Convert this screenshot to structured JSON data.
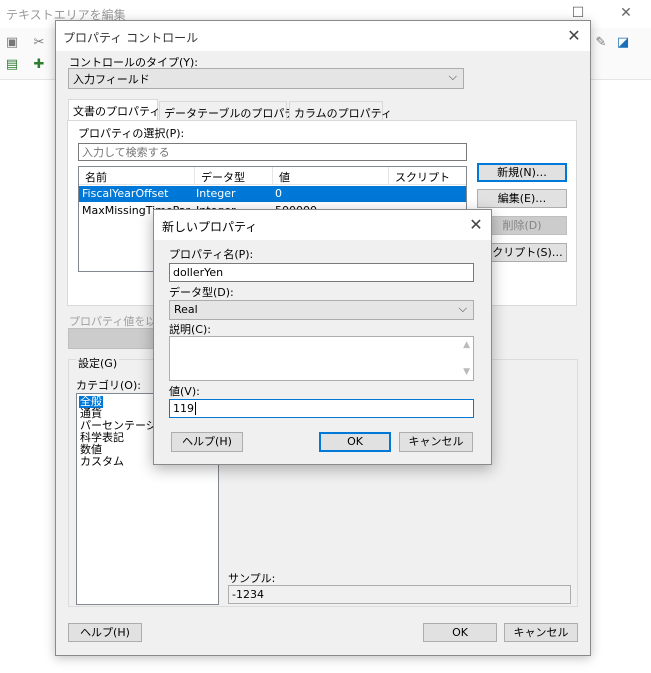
{
  "background_app": {
    "title": "テキストエリアを編集"
  },
  "property_dialog": {
    "title": "プロパティ コントロール",
    "control_type_label": "コントロールのタイプ(Y):",
    "control_type_value": "入力フィールド",
    "tabs": [
      {
        "label": "文書のプロパティ",
        "active": true
      },
      {
        "label": "データテーブルのプロパティ",
        "active": false
      },
      {
        "label": "カラムのプロパティ",
        "active": false
      }
    ],
    "select_property_label": "プロパティの選択(P):",
    "search_placeholder": "入力して検索する",
    "table": {
      "columns": [
        "名前",
        "データ型",
        "値",
        "スクリプト"
      ],
      "rows": [
        {
          "name": "FiscalYearOffset",
          "type": "Integer",
          "value": "0",
          "script": "",
          "selected": true
        },
        {
          "name": "MaxMissingTimePar...",
          "type": "Integer",
          "value": "500000",
          "script": "",
          "selected": false
        }
      ]
    },
    "side_buttons": {
      "new": "新規(N)…",
      "edit": "編集(E)…",
      "delete": "削除(D)",
      "script": "スクリプト(S)…"
    },
    "property_value_label": "プロパティ値を以下",
    "settings_label": "設定(G)",
    "category_label": "カテゴリ(O):",
    "categories": [
      "全般",
      "通貨",
      "パーセンテージ",
      "科学表記",
      "数値",
      "カスタム"
    ],
    "selected_category": "全般",
    "sample_label": "サンプル:",
    "sample_value": "-1234",
    "help_button": "ヘルプ(H)",
    "ok_button": "OK",
    "cancel_button": "キャンセル"
  },
  "new_property_dialog": {
    "title": "新しいプロパティ",
    "name_label": "プロパティ名(P):",
    "name_value": "dollerYen",
    "datatype_label": "データ型(D):",
    "datatype_value": "Real",
    "description_label": "説明(C):",
    "description_value": "",
    "value_label": "値(V):",
    "value_value": "119",
    "help_button": "ヘルプ(H)",
    "ok_button": "OK",
    "cancel_button": "キャンセル"
  }
}
